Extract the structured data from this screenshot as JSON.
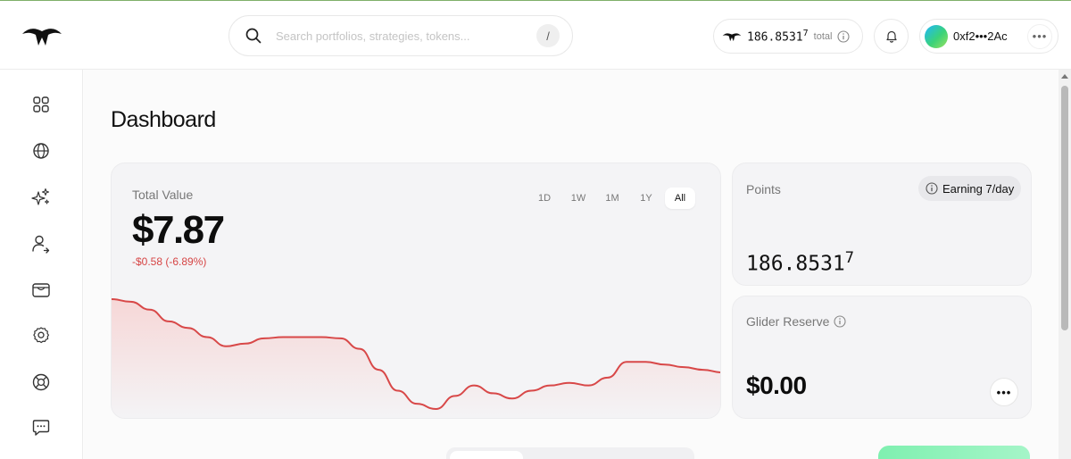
{
  "header": {
    "search": {
      "placeholder": "Search portfolios, strategies, tokens...",
      "value": "",
      "shortcut": "/"
    },
    "points": {
      "value": "186.8531",
      "superscript": "7",
      "label": "total"
    },
    "wallet": {
      "address": "0xf2•••2Ac"
    }
  },
  "sidebar": {
    "items": [
      {
        "id": "dashboard",
        "icon": "grid-icon"
      },
      {
        "id": "explore",
        "icon": "globe-icon"
      },
      {
        "id": "strategies",
        "icon": "sparkles-icon"
      },
      {
        "id": "referrals",
        "icon": "user-share-icon"
      },
      {
        "id": "wallet",
        "icon": "wallet-icon"
      },
      {
        "id": "settings",
        "icon": "gear-icon"
      },
      {
        "id": "support",
        "icon": "lifebuoy-icon"
      },
      {
        "id": "feedback",
        "icon": "chat-icon"
      }
    ]
  },
  "main": {
    "title": "Dashboard",
    "total_value": {
      "label": "Total Value",
      "value": "$7.87",
      "change": "-$0.58 (-6.89%)",
      "ranges": [
        "1D",
        "1W",
        "1M",
        "1Y",
        "All"
      ],
      "active_range": "All"
    },
    "points_card": {
      "label": "Points",
      "badge": "Earning 7/day",
      "value": "186.8531",
      "superscript": "7"
    },
    "reserve_card": {
      "label": "Glider Reserve",
      "value": "$0.00"
    }
  },
  "chart_data": {
    "type": "area",
    "series": [
      {
        "values": [
          0.72,
          0.7,
          0.64,
          0.55,
          0.5,
          0.43,
          0.36,
          0.38,
          0.42,
          0.43,
          0.43,
          0.43,
          0.42,
          0.34,
          0.18,
          0.02,
          -0.08,
          -0.12,
          -0.02,
          0.06,
          0.0,
          -0.04,
          0.02,
          0.06,
          0.08,
          0.06,
          0.12,
          0.24,
          0.24,
          0.22,
          0.2,
          0.18,
          0.16
        ]
      }
    ],
    "grid": false,
    "colors": {
      "line": "#d84848",
      "fill_top": "#f6d7d7",
      "fill_bottom": "#f4f4f6"
    }
  }
}
